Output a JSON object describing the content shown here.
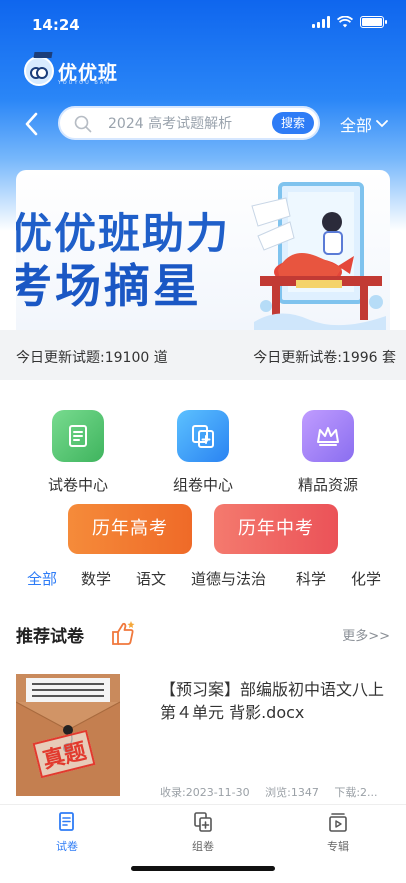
{
  "status_bar": {
    "time": "14:24"
  },
  "app": {
    "logo_text": "优优班",
    "logo_subtext": "YOUYOU BAN"
  },
  "search": {
    "placeholder": "2024 高考试题解析",
    "button_label": "搜索",
    "filter_label": "全部"
  },
  "banner": {
    "line1": "优优班助力",
    "line2": "考场摘星"
  },
  "stats": {
    "today_questions": "今日更新试题:19100 道",
    "today_papers": "今日更新试卷:1996 套"
  },
  "quick_actions": [
    {
      "label": "试卷中心",
      "icon": "paper-center-icon",
      "color": "#4cc46b"
    },
    {
      "label": "组卷中心",
      "icon": "compose-paper-icon",
      "color": "#2f8ff5"
    },
    {
      "label": "精品资源",
      "icon": "crown-icon",
      "color": "#9b7cf0"
    }
  ],
  "big_buttons": [
    {
      "label": "历年高考",
      "color": "#f0702a"
    },
    {
      "label": "历年中考",
      "color": "#ee5a5a"
    }
  ],
  "subjects": [
    "全部",
    "数学",
    "语文",
    "道德与法治",
    "科学",
    "化学"
  ],
  "active_subject": "全部",
  "recommend": {
    "title": "推荐试卷",
    "more": "更多>>"
  },
  "papers": [
    {
      "stamp": "真题",
      "title": "【预习案】部编版初中语文八上 第４单元  背影.docx",
      "date": "收录:2023-11-30",
      "views": "浏览:1347",
      "downloads": "下载:2..."
    }
  ],
  "tabs": [
    {
      "label": "试卷",
      "icon": "paper-icon",
      "active": true
    },
    {
      "label": "组卷",
      "icon": "compose-icon",
      "active": false
    },
    {
      "label": "专辑",
      "icon": "album-icon",
      "active": false
    }
  ],
  "colors": {
    "primary": "#2e7cf6",
    "header_top": "#0f66ee"
  }
}
